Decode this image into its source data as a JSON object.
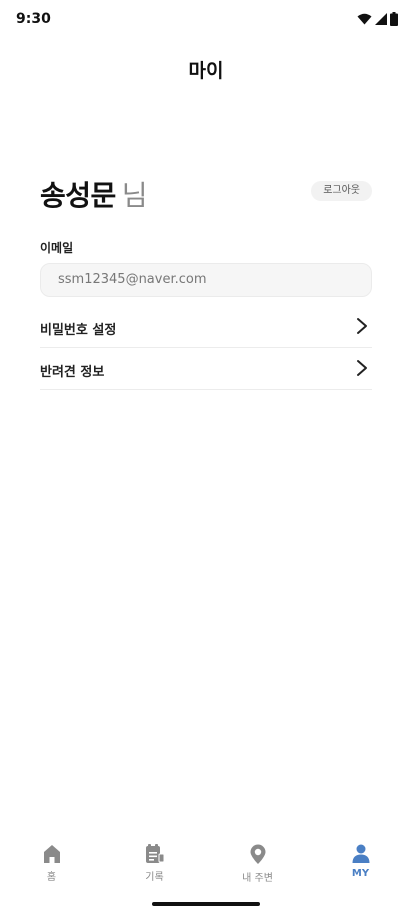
{
  "status_bar": {
    "time": "9:30",
    "icons": [
      "wifi-icon",
      "signal-icon",
      "battery-icon"
    ]
  },
  "header": {
    "title": "마이"
  },
  "profile": {
    "name": "송성문",
    "suffix": "님",
    "logout_label": "로그아웃"
  },
  "email": {
    "label": "이메일",
    "value": "ssm12345@naver.com"
  },
  "menu": {
    "items": [
      {
        "label": "비밀번호 설정",
        "icon": "chevron-right-icon"
      },
      {
        "label": "반려견 정보",
        "icon": "chevron-right-icon"
      }
    ]
  },
  "bottom_nav": {
    "items": [
      {
        "label": "홈",
        "icon": "home-icon",
        "active": false
      },
      {
        "label": "기록",
        "icon": "record-icon",
        "active": false
      },
      {
        "label": "내 주변",
        "icon": "location-pin-icon",
        "active": false
      },
      {
        "label": "MY",
        "icon": "person-icon",
        "active": true
      }
    ],
    "active_color": "#4a7fc4",
    "inactive_color": "#888888"
  }
}
